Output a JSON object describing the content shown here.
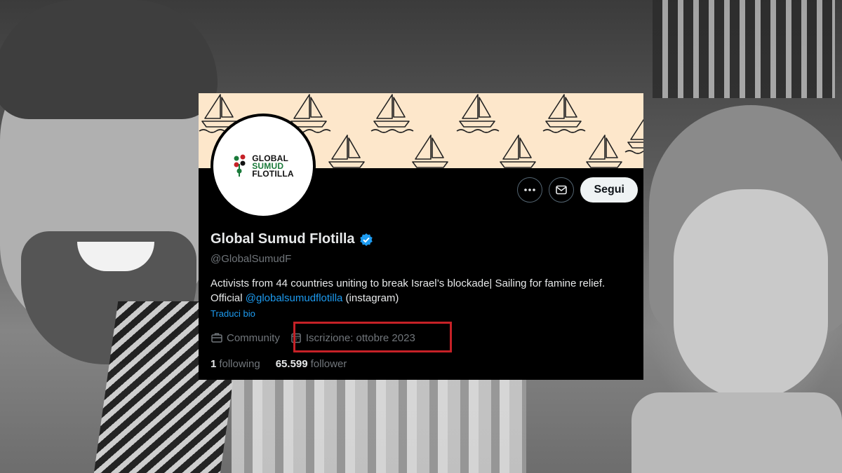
{
  "profile": {
    "display_name": "Global Sumud Flotilla",
    "handle": "@GlobalSumudF",
    "bio_text": "Activists from 44 countries uniting to break Israel’s blockade| Sailing for famine relief. Official ",
    "bio_mention": "@globalsumudflotilla",
    "bio_suffix": " (instagram)",
    "translate_link": "Traduci bio",
    "category": "Community",
    "joined": "Iscrizione: ottobre 2023",
    "following_count": "1",
    "following_label": "following",
    "followers_count": "65.599",
    "followers_label": "follower",
    "verified": true
  },
  "avatar_logo": {
    "line1": "GLOBAL",
    "line2": "SUMUD",
    "line3": "FLOTILLA"
  },
  "actions": {
    "more_icon": "more-horizontal-icon",
    "message_icon": "envelope-icon",
    "follow_label": "Segui"
  },
  "colors": {
    "accent": "#1d9bf0",
    "banner": "#fde7cb",
    "highlight_box": "#c62127",
    "card_bg": "#000000"
  }
}
